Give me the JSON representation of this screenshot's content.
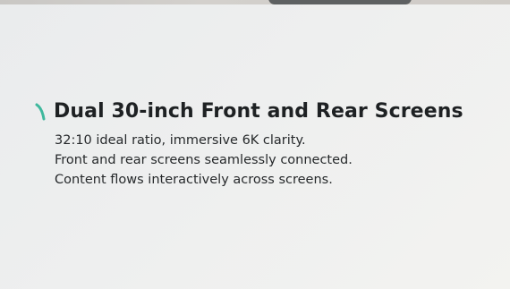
{
  "feature": {
    "title": "Dual 30-inch Front and Rear Screens",
    "lines": [
      "32:10 ideal ratio, immersive 6K clarity.",
      "Front and rear screens seamlessly connected.",
      "Content flows interactively across screens."
    ],
    "accent_icon": "slash-accent-icon",
    "accent_color": "#3fb89d"
  }
}
